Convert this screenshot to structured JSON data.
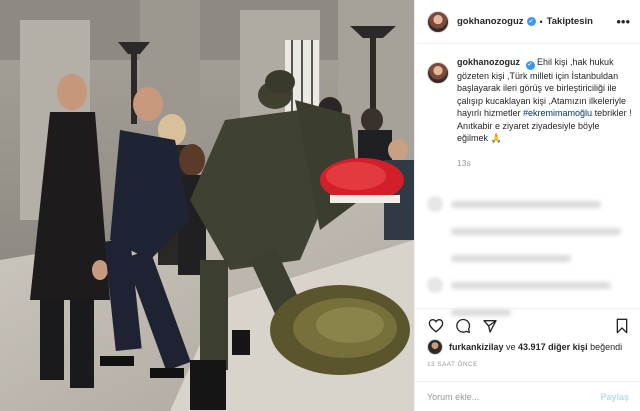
{
  "post": {
    "username": "gokhanozoguz",
    "separator": "•",
    "follow_status": "Takiptesin",
    "more_icon": "ellipsis-icon",
    "caption_parts": {
      "text_before_hashtag": "Ehil kişi ,hak hukuk gözeten kişi ,Türk milleti için İstanbuldan başlayarak ileri görüş ve birleştiriciliği ile çalışıp kucaklayan kişi ,Atamızın ilkeleriyle hayırlı hizmetler ",
      "hashtag": "#ekremimamoğlu",
      "text_after_hashtag": " tebrikler ! Anıtkabir e ziyaret ziyadesiyle böyle eğilmek 🙏"
    },
    "caption_time": "13s",
    "liked_by_user": "furkankizilay",
    "likes_middle": " ve ",
    "likes_count": "43.917 diğer kişi",
    "likes_suffix": " beğendi",
    "post_time": "13 SAAT ÖNCE",
    "comment_placeholder": "Yorum ekle...",
    "post_button": "Paylaş"
  },
  "icons": {
    "like": "heart-icon",
    "comment": "comment-icon",
    "share": "share-icon",
    "save": "bookmark-icon"
  },
  "colors": {
    "verified": "#3897f0",
    "hashtag": "#003569",
    "post_button_disabled": "#b2dffc",
    "muted_text": "#999999"
  }
}
